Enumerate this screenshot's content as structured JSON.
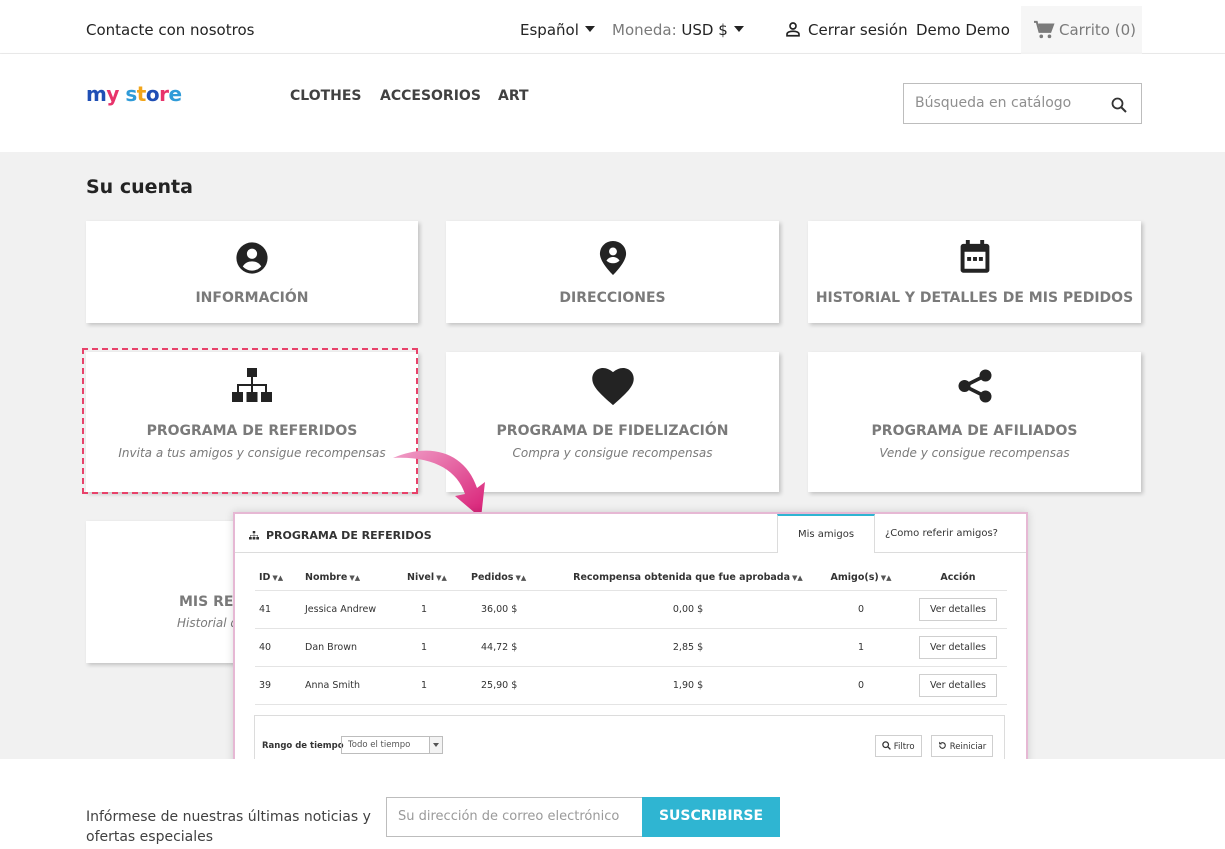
{
  "topbar": {
    "contact": "Contacte con nosotros",
    "language": "Español",
    "currency_label": "Moneda:",
    "currency_value": "USD $",
    "logout": "Cerrar sesión",
    "user": "Demo Demo",
    "cart": "Carrito (0)"
  },
  "header": {
    "logo": "my store",
    "nav": [
      "CLOTHES",
      "ACCESORIOS",
      "ART"
    ],
    "search_placeholder": "Búsqueda en catálogo"
  },
  "account": {
    "title": "Su cuenta",
    "cards": [
      {
        "label": "INFORMACIÓN",
        "icon": "account-circle-icon"
      },
      {
        "label": "DIRECCIONES",
        "icon": "location-pin-icon"
      },
      {
        "label": "HISTORIAL Y DETALLES DE MIS PEDIDOS",
        "icon": "calendar-icon"
      },
      {
        "label": "PROGRAMA DE REFERIDOS",
        "sub": "Invita a tus amigos y consigue recompensas",
        "icon": "sitemap-icon"
      },
      {
        "label": "PROGRAMA DE FIDELIZACIÓN",
        "sub": "Compra y consigue recompensas",
        "icon": "heart-icon"
      },
      {
        "label": "PROGRAMA DE AFILIADOS",
        "sub": "Vende y consigue recompensas",
        "icon": "share-icon"
      },
      {
        "label": "MIS RE",
        "sub": "Historial d"
      }
    ]
  },
  "referral_panel": {
    "title": "PROGRAMA DE REFERIDOS",
    "tabs": [
      "Mis amigos",
      "¿Como referir amigos?"
    ],
    "columns": [
      "ID",
      "Nombre",
      "Nivel",
      "Pedidos",
      "Recompensa obtenida que fue aprobada",
      "Amigo(s)",
      "Acción"
    ],
    "rows": [
      {
        "id": "41",
        "name": "Jessica Andrew",
        "level": "1",
        "orders": "36,00 $",
        "reward": "0,00 $",
        "friends": "0",
        "action": "Ver detalles"
      },
      {
        "id": "40",
        "name": "Dan Brown",
        "level": "1",
        "orders": "44,72 $",
        "reward": "2,85 $",
        "friends": "1",
        "action": "Ver detalles"
      },
      {
        "id": "39",
        "name": "Anna Smith",
        "level": "1",
        "orders": "25,90 $",
        "reward": "1,90 $",
        "friends": "0",
        "action": "Ver detalles"
      }
    ],
    "time_range_label": "Rango de tiempo",
    "time_range_value": "Todo el tiempo",
    "filter_button": "Filtro",
    "reset_button": "Reiniciar"
  },
  "footer": {
    "newsletter_text_1": "Infórmese de nuestras últimas noticias y",
    "newsletter_text_2": "ofertas especiales",
    "email_placeholder": "Su dirección de correo electrónico",
    "subscribe": "SUSCRIBIRSE"
  },
  "colors": {
    "accent": "#2fb5d2",
    "highlight": "#e8426a"
  }
}
